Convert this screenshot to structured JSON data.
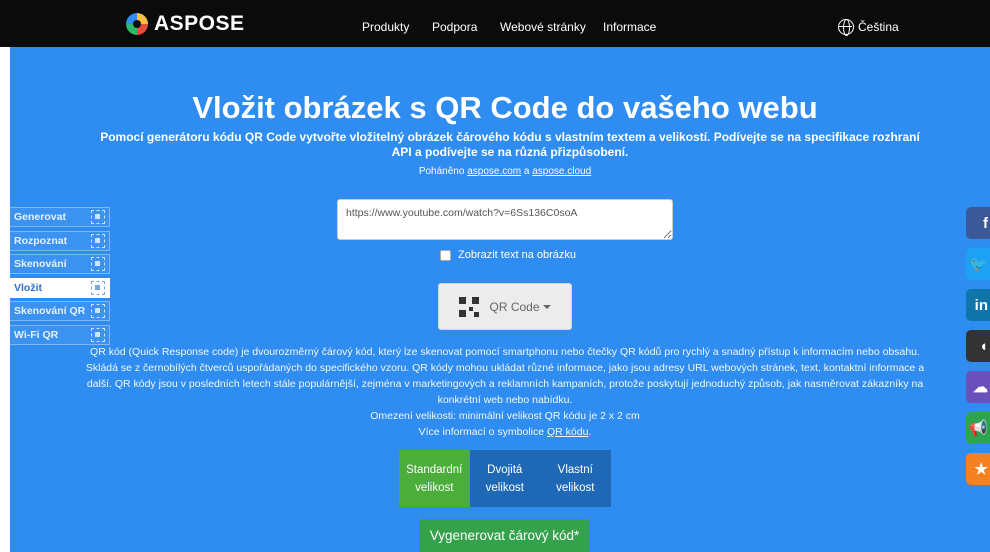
{
  "header": {
    "brand": "ASPOSE",
    "nav": [
      "Produkty",
      "Podpora",
      "Webové stránky",
      "Informace"
    ],
    "language": "Čeština"
  },
  "hero": {
    "title": "Vložit obrázek s QR Code do vašeho webu",
    "subtitle": "Pomocí generátoru kódu QR Code vytvořte vložitelný obrázek čárového kódu s vlastním textem a velikostí. Podívejte se na specifikace rozhraní API a podívejte se na různá přizpůsobení.",
    "powered_prefix": "Poháněno",
    "powered_link1": "aspose.com",
    "powered_and": "a",
    "powered_link2": "aspose.cloud"
  },
  "sidemenu": {
    "items": [
      {
        "label": "Generovat",
        "active": false
      },
      {
        "label": "Rozpoznat",
        "active": false
      },
      {
        "label": "Skenování",
        "active": false
      },
      {
        "label": "Vložit",
        "active": true
      },
      {
        "label": "Skenování QR",
        "active": false
      },
      {
        "label": "Wi-Fi QR",
        "active": false
      }
    ]
  },
  "form": {
    "url_value": "https://www.youtube.com/watch?v=6Ss136C0soA",
    "show_text_label": "Zobrazit text na obrázku",
    "show_text_checked": false,
    "barcode_type": "QR Code"
  },
  "description": {
    "paragraph": "QR kód (Quick Response code) je dvourozměrný čárový kód, který lze skenovat pomocí smartphonu nebo čtečky QR kódů pro rychlý a snadný přístup k informacím nebo obsahu. Skládá se z černobílých čtverců uspořádaných do specifického vzoru. QR kódy mohou ukládat různé informace, jako jsou adresy URL webových stránek, text, kontaktní informace a další. QR kódy jsou v posledních letech stále populárnější, zejména v marketingových a reklamních kampaních, protože poskytují jednoduchý způsob, jak nasměrovat zákazníky na konkrétní web nebo nabídku.",
    "size_limit": "Omezení velikosti: minimální velikost QR kódu je 2 x 2 cm",
    "more_info_prefix": "Více informací o symbolice",
    "more_info_link": "QR kódu",
    "more_info_suffix": "."
  },
  "size_options": [
    {
      "line1": "Standardní",
      "line2": "velikost",
      "active": true
    },
    {
      "line1": "Dvojitá",
      "line2": "velikost",
      "active": false
    },
    {
      "line1": "Vlastní",
      "line2": "velikost",
      "active": false
    }
  ],
  "generate_label": "Vygenerovat čárový kód*",
  "social": [
    {
      "icon": "facebook-icon",
      "glyph": "f",
      "color": "#3b5998"
    },
    {
      "icon": "twitter-icon",
      "glyph": "🐦",
      "color": "#1da1f2"
    },
    {
      "icon": "linkedin-icon",
      "glyph": "in",
      "color": "#0e76a8"
    },
    {
      "icon": "github-icon",
      "glyph": "◖",
      "color": "#333333"
    },
    {
      "icon": "cloud-icon",
      "glyph": "☁",
      "color": "#6b4fbb"
    },
    {
      "icon": "megaphone-icon",
      "glyph": "📢",
      "color": "#2ea44f"
    },
    {
      "icon": "star-icon",
      "glyph": "★",
      "color": "#f58220"
    }
  ]
}
